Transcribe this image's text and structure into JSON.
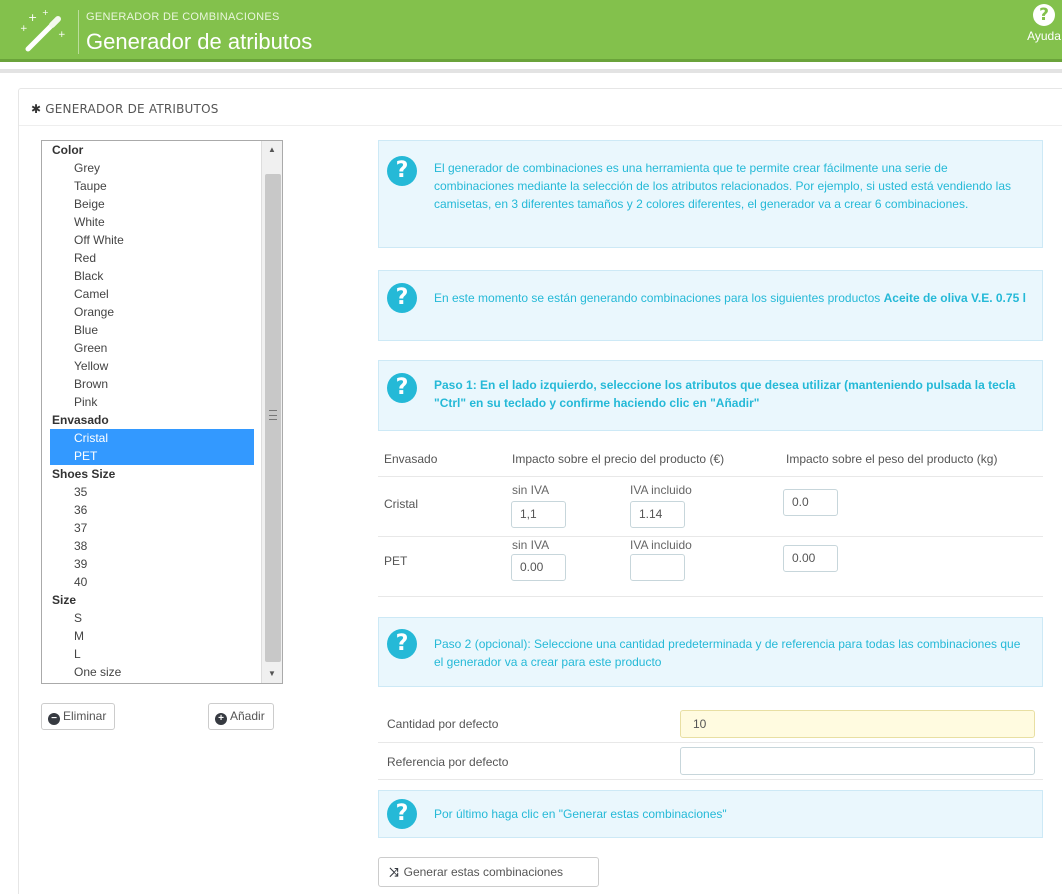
{
  "header": {
    "breadcrumb": "GENERADOR DE COMBINACIONES",
    "title": "Generador de atributos",
    "help_label": "Ayuda",
    "help_glyph": "?",
    "bar_color": "#83c14c"
  },
  "panel": {
    "heading_icon": "✱",
    "heading": "GENERADOR DE ATRIBUTOS"
  },
  "attribute_groups": [
    {
      "name": "Color",
      "options": [
        "Grey",
        "Taupe",
        "Beige",
        "White",
        "Off White",
        "Red",
        "Black",
        "Camel",
        "Orange",
        "Blue",
        "Green",
        "Yellow",
        "Brown",
        "Pink"
      ]
    },
    {
      "name": "Envasado",
      "options": [
        "Cristal",
        "PET"
      ]
    },
    {
      "name": "Shoes Size",
      "options": [
        "35",
        "36",
        "37",
        "38",
        "39",
        "40"
      ]
    },
    {
      "name": "Size",
      "options": [
        "S",
        "M",
        "L",
        "One size"
      ]
    }
  ],
  "selected_options": [
    "Cristal",
    "PET"
  ],
  "buttons": {
    "remove": "Eliminar",
    "remove_icon": "−",
    "add": "Añadir",
    "add_icon": "+",
    "generate": "Generar estas combinaciones",
    "generate_icon": "⤨"
  },
  "info": {
    "icon": "?",
    "intro": "El generador de combinaciones es una herramienta que te permite crear fácilmente una serie de combinaciones mediante la selección de los atributos relacionados. Por ejemplo, si usted está vendiendo las camisetas, en 3 diferentes tamaños y 2 colores diferentes, el generador va a crear 6 combinaciones.",
    "product_prefix": "En este momento se están generando combinaciones para los siguientes productos ",
    "product_name": "Aceite de oliva V.E. 0.75 l",
    "step1": "Paso 1: En el lado izquierdo, seleccione los atributos que desea utilizar (manteniendo pulsada la tecla \"Ctrl\" en su teclado y confirme haciendo clic en \"Añadir\"",
    "step2": "Paso 2 (opcional): Seleccione una cantidad predeterminada y de referencia para todas las combinaciones que el generador va a crear para este producto",
    "final": "Por último haga clic en \"Generar estas combinaciones\""
  },
  "impact_table": {
    "headers": [
      "Envasado",
      "Impacto sobre el precio del producto (€)",
      "Impacto sobre el peso del producto (kg)"
    ],
    "sub_headers": {
      "tax_excl": "sin IVA",
      "tax_incl": "IVA incluido"
    },
    "rows": [
      {
        "label": "Cristal",
        "price_excl": "1,1",
        "price_incl": "1.14",
        "weight": "0.0"
      },
      {
        "label": "PET",
        "price_excl": "0.00",
        "price_incl": "",
        "weight": "0.00"
      }
    ]
  },
  "defaults": {
    "quantity_label": "Cantidad por defecto",
    "quantity_value": "10",
    "reference_label": "Referencia por defecto",
    "reference_value": ""
  },
  "colors": {
    "info_text": "#25b9d7",
    "info_bg": "#eaf7fd",
    "selection": "#3399ff"
  }
}
